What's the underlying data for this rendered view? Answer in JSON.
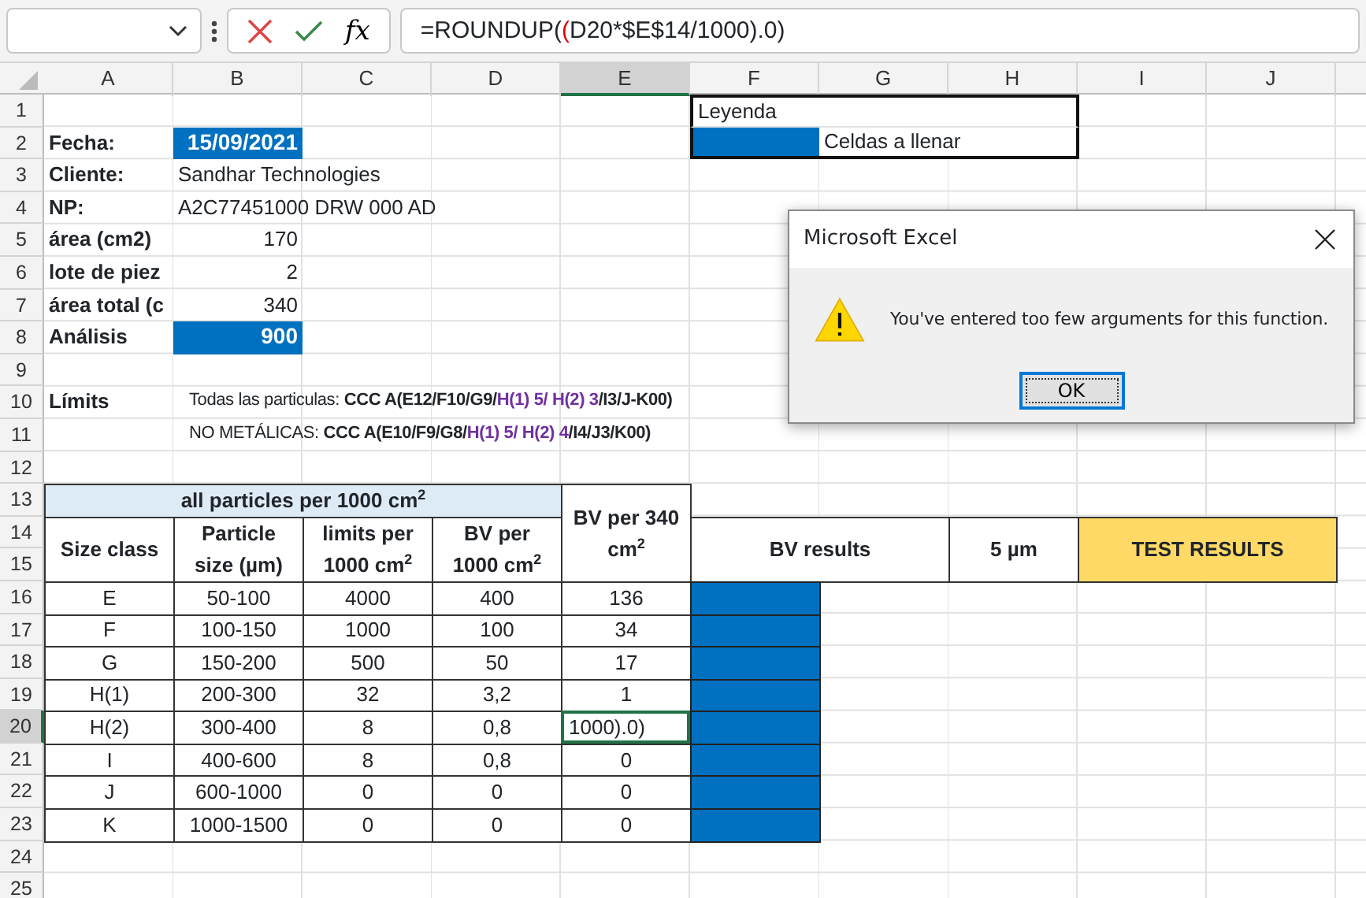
{
  "formula_bar": {
    "function_label": "fx",
    "formula": [
      {
        "kind": "plain",
        "text": "=ROUNDUP("
      },
      {
        "kind": "paren",
        "text": "("
      },
      {
        "kind": "plain",
        "text": "D20*$E$14/1000).0)"
      }
    ]
  },
  "sheet": {
    "columns": [
      "A",
      "B",
      "C",
      "D",
      "E",
      "F",
      "G",
      "H",
      "I",
      "J"
    ],
    "rows": [
      {
        "number": "1",
        "cells": [
          null,
          null,
          null,
          null,
          null,
          {
            "kind": "legend-title",
            "text": "Leyenda"
          },
          {
            "kind": "merge-left"
          },
          {
            "kind": "merge-left"
          }
        ]
      },
      {
        "number": "2",
        "cells": [
          {
            "kind": "label",
            "text": "Fecha:"
          },
          {
            "kind": "input",
            "text": "15/09/2021"
          },
          null,
          null,
          null,
          {
            "kind": "legend-swatch"
          },
          {
            "kind": "legend-note",
            "text": "Celdas a llenar"
          },
          {
            "kind": "merge-left"
          }
        ]
      },
      {
        "number": "3",
        "cells": [
          {
            "kind": "label",
            "text": "Cliente:"
          },
          {
            "kind": "text",
            "text": "Sandhar Technologies"
          }
        ]
      },
      {
        "number": "4",
        "cells": [
          {
            "kind": "label",
            "text": "NP:"
          },
          {
            "kind": "text",
            "text": "A2C77451000 DRW 000 AD"
          }
        ]
      },
      {
        "number": "5",
        "cells": [
          {
            "kind": "label",
            "text": "área (cm2)"
          },
          {
            "kind": "number",
            "text": "170"
          }
        ]
      },
      {
        "number": "6",
        "cells": [
          {
            "kind": "label",
            "text": "lote de piez"
          },
          {
            "kind": "number",
            "text": "2"
          }
        ]
      },
      {
        "number": "7",
        "cells": [
          {
            "kind": "label",
            "text": "área total (c"
          },
          {
            "kind": "number",
            "text": "340"
          }
        ]
      },
      {
        "number": "8",
        "cells": [
          {
            "kind": "label",
            "text": "Análisis"
          },
          {
            "kind": "input",
            "text": "900"
          }
        ]
      },
      {
        "number": "9"
      },
      {
        "number": "10",
        "cells": [
          {
            "kind": "label",
            "text": "Límits"
          },
          {
            "kind": "note",
            "segments": [
              {
                "kind": "plain",
                "text": "Todas las particulas: "
              },
              {
                "kind": "bold",
                "text": "CCC A(E12/F10/G9/"
              },
              {
                "kind": "accent",
                "text": "H(1) 5/ H(2) 3"
              },
              {
                "kind": "bold",
                "text": "/I3/J-K00)"
              }
            ]
          }
        ]
      },
      {
        "number": "11",
        "cells": [
          null,
          {
            "kind": "note",
            "segments": [
              {
                "kind": "plain",
                "text": "NO METÁLICAS: "
              },
              {
                "kind": "bold",
                "text": "CCC A(E10/F9/G8/"
              },
              {
                "kind": "accent",
                "text": "H(1) 5/ H(2) 4"
              },
              {
                "kind": "bold",
                "text": "/I4/J3/K00)"
              }
            ]
          }
        ]
      },
      {
        "number": "12"
      },
      {
        "number": "13",
        "cells": [
          {
            "kind": "title",
            "text": "all particles per 1000 cm$^{2}$"
          },
          {
            "kind": "merge-left"
          },
          {
            "kind": "merge-left"
          },
          {
            "kind": "merge-left"
          },
          {
            "kind": "th",
            "text": "BV per 340 cm$^{2}$"
          }
        ]
      },
      {
        "number": "14",
        "cells": [
          {
            "kind": "th",
            "text": "Size class"
          },
          {
            "kind": "th",
            "text": "Particle size (µm)"
          },
          {
            "kind": "th",
            "text": "limits per 1000 cm$^{2}$"
          },
          {
            "kind": "th",
            "text": "BV per 1000 cm$^{2}$"
          },
          {
            "kind": "merge-up"
          },
          {
            "kind": "th",
            "text": "BV results"
          },
          {
            "kind": "merge-left"
          },
          {
            "kind": "th",
            "text": "5 µm"
          },
          {
            "kind": "result",
            "text": "TEST RESULTS"
          },
          {
            "kind": "merge-left"
          }
        ]
      },
      {
        "number": "15",
        "cells": [
          {
            "kind": "merge-up"
          },
          {
            "kind": "merge-up"
          },
          {
            "kind": "merge-up"
          },
          {
            "kind": "merge-up"
          },
          {
            "kind": "merge-up"
          },
          {
            "kind": "merge-up"
          },
          {
            "kind": "merge-up"
          },
          {
            "kind": "merge-up"
          },
          {
            "kind": "merge-up"
          },
          {
            "kind": "merge-up"
          }
        ]
      },
      {
        "number": "16",
        "cells": [
          {
            "kind": "td",
            "text": "E"
          },
          {
            "kind": "td",
            "text": "50-100"
          },
          {
            "kind": "td",
            "text": "4000"
          },
          {
            "kind": "td",
            "text": "400"
          },
          {
            "kind": "td",
            "text": "136"
          },
          {
            "kind": "fill"
          }
        ]
      },
      {
        "number": "17",
        "cells": [
          {
            "kind": "td",
            "text": "F"
          },
          {
            "kind": "td",
            "text": "100-150"
          },
          {
            "kind": "td",
            "text": "1000"
          },
          {
            "kind": "td",
            "text": "100"
          },
          {
            "kind": "td",
            "text": "34"
          },
          {
            "kind": "fill"
          }
        ]
      },
      {
        "number": "18",
        "cells": [
          {
            "kind": "td",
            "text": "G"
          },
          {
            "kind": "td",
            "text": "150-200"
          },
          {
            "kind": "td",
            "text": "500"
          },
          {
            "kind": "td",
            "text": "50"
          },
          {
            "kind": "td",
            "text": "17"
          },
          {
            "kind": "fill"
          }
        ]
      },
      {
        "number": "19",
        "cells": [
          {
            "kind": "td",
            "text": "H(1)"
          },
          {
            "kind": "td",
            "text": "200-300"
          },
          {
            "kind": "td",
            "text": "32"
          },
          {
            "kind": "td",
            "text": "3,2"
          },
          {
            "kind": "td",
            "text": "1"
          },
          {
            "kind": "fill"
          }
        ]
      },
      {
        "number": "20",
        "cells": [
          {
            "kind": "td",
            "text": "H(2)"
          },
          {
            "kind": "td",
            "text": "300-400"
          },
          {
            "kind": "td",
            "text": "8"
          },
          {
            "kind": "td",
            "text": "0,8"
          },
          {
            "kind": "editing",
            "text": "1000).0)"
          },
          {
            "kind": "fill"
          }
        ]
      },
      {
        "number": "21",
        "cells": [
          {
            "kind": "td",
            "text": "I"
          },
          {
            "kind": "td",
            "text": "400-600"
          },
          {
            "kind": "td",
            "text": "8"
          },
          {
            "kind": "td",
            "text": "0,8"
          },
          {
            "kind": "td",
            "text": "0"
          },
          {
            "kind": "fill"
          }
        ]
      },
      {
        "number": "22",
        "cells": [
          {
            "kind": "td",
            "text": "J"
          },
          {
            "kind": "td",
            "text": "600-1000"
          },
          {
            "kind": "td",
            "text": "0"
          },
          {
            "kind": "td",
            "text": "0"
          },
          {
            "kind": "td",
            "text": "0"
          },
          {
            "kind": "fill"
          }
        ]
      },
      {
        "number": "23",
        "cells": [
          {
            "kind": "td",
            "text": "K"
          },
          {
            "kind": "td",
            "text": "1000-1500"
          },
          {
            "kind": "td",
            "text": "0"
          },
          {
            "kind": "td",
            "text": "0"
          },
          {
            "kind": "td",
            "text": "0"
          },
          {
            "kind": "fill"
          }
        ]
      },
      {
        "number": "24"
      },
      {
        "number": "25"
      }
    ]
  },
  "dialog": {
    "title": "Microsoft Excel",
    "message": "You've entered too few arguments for this function.",
    "buttons": [
      "OK"
    ]
  }
}
